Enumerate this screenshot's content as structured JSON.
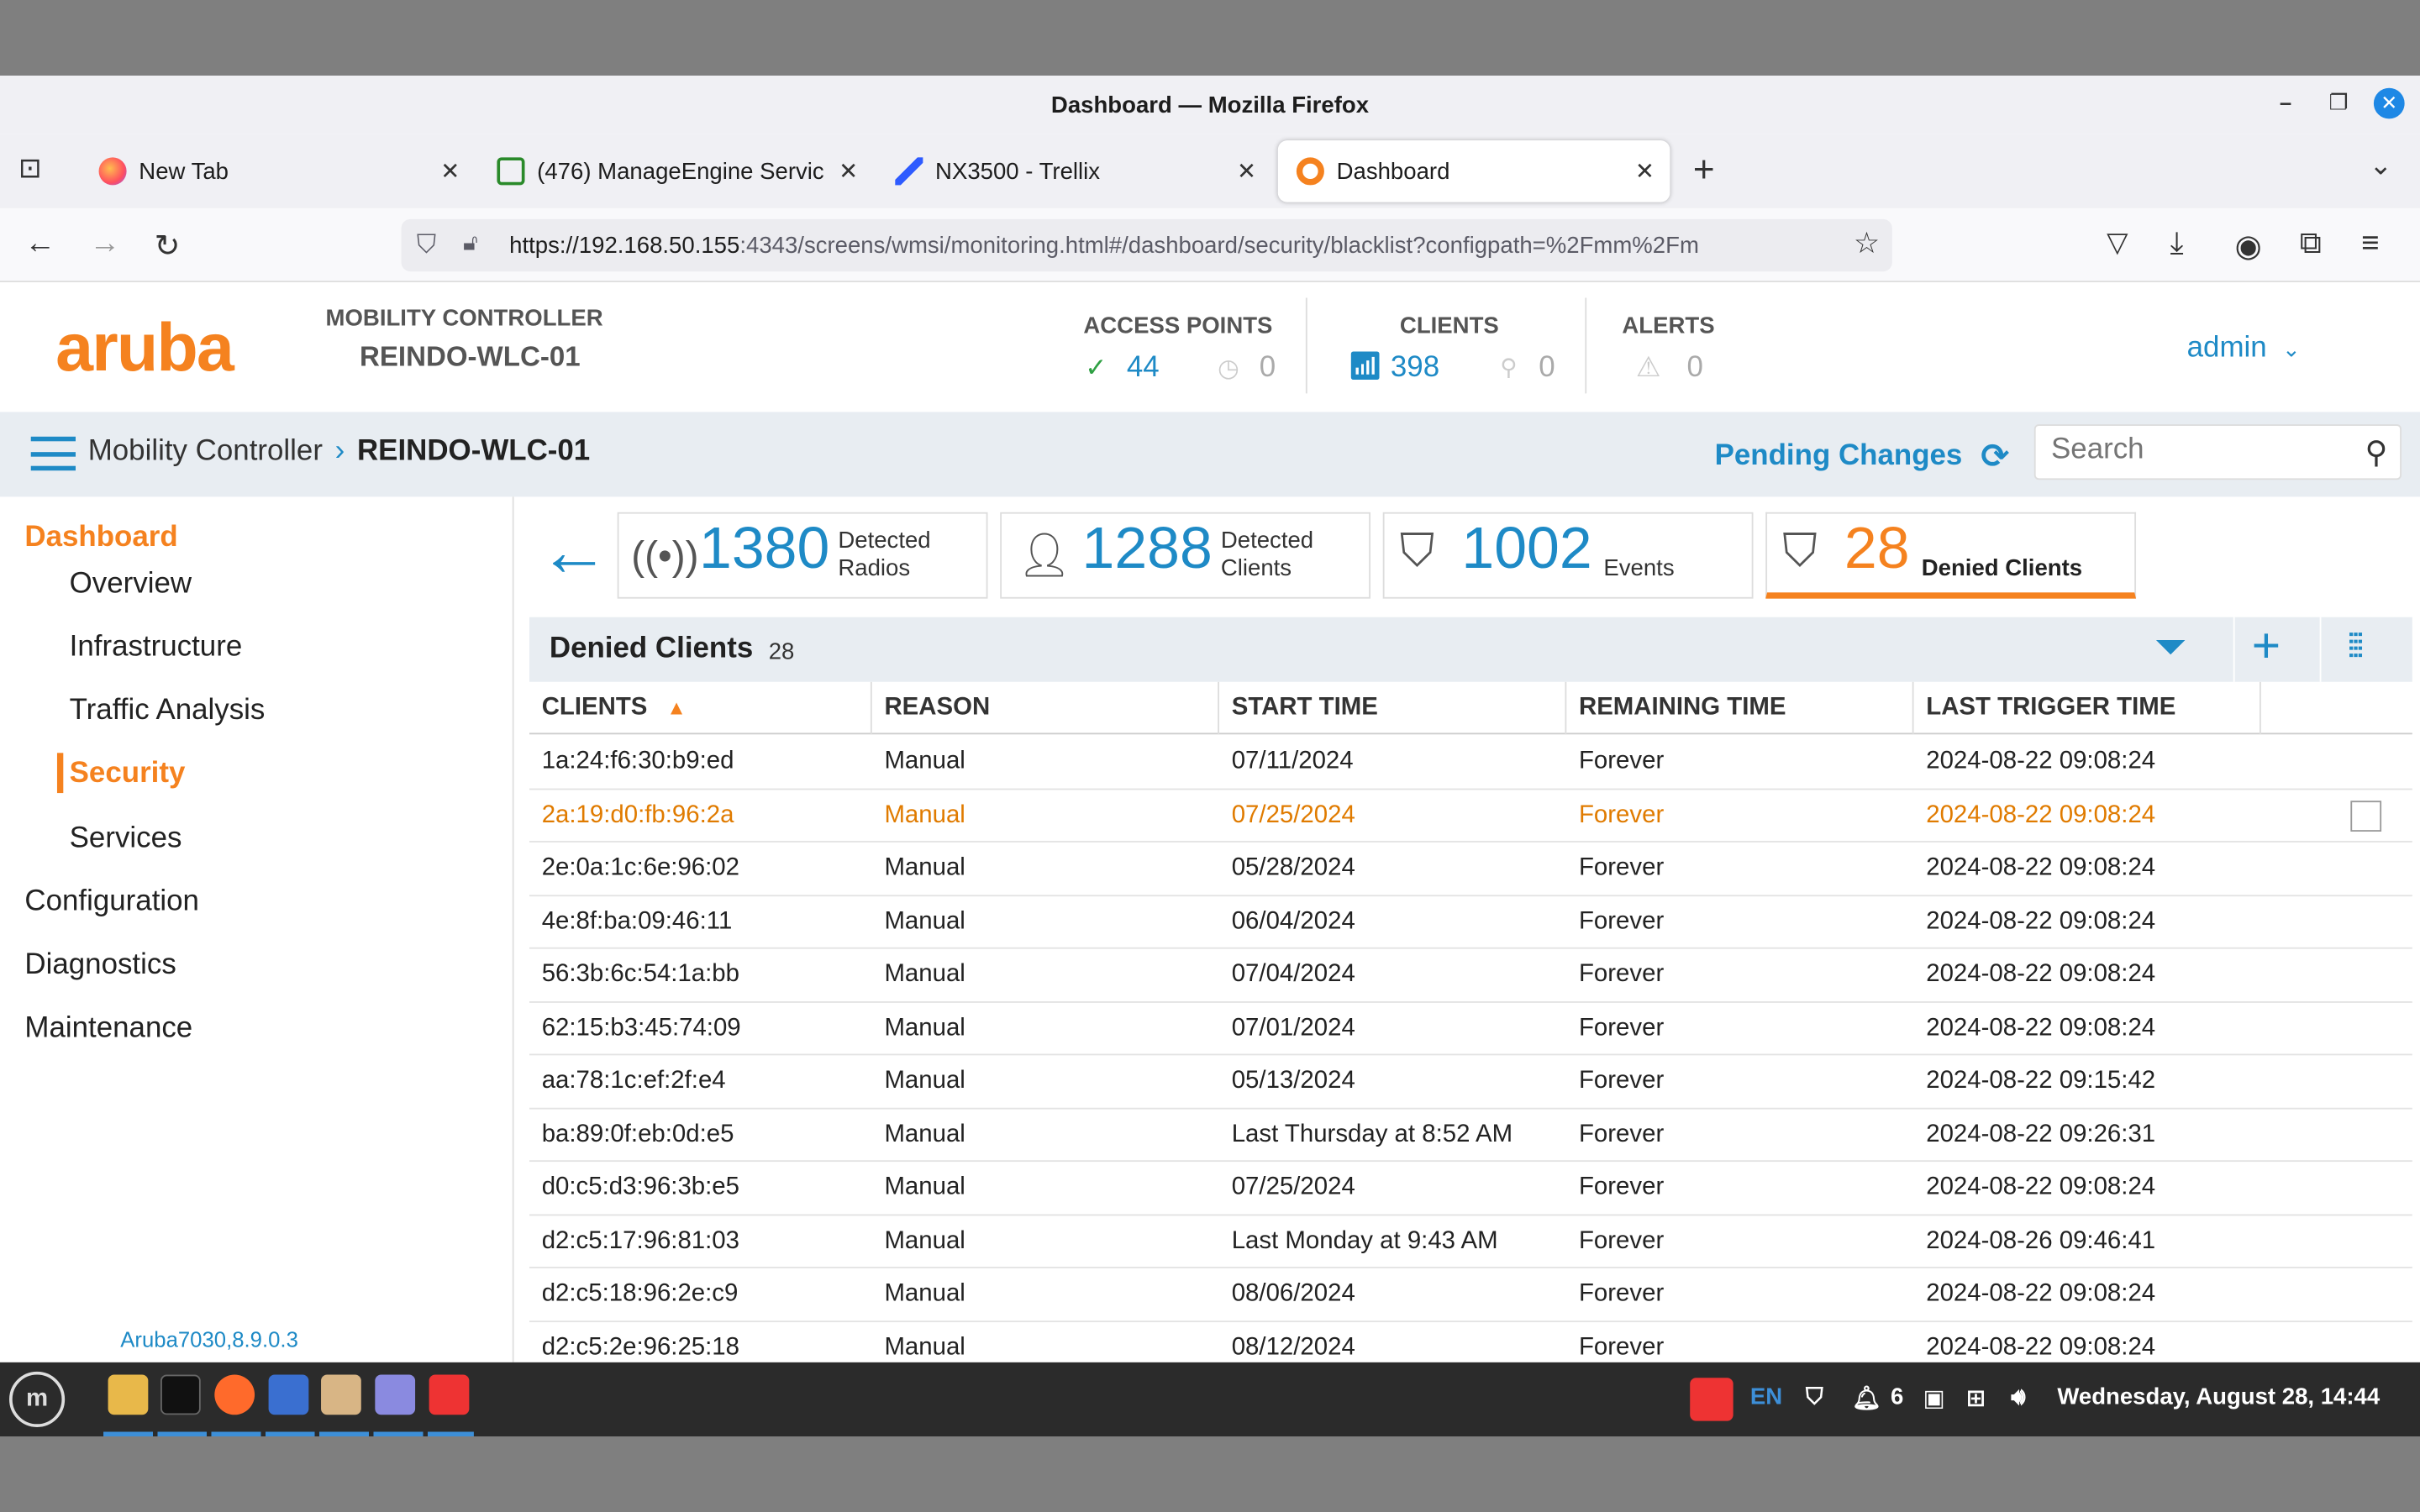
{
  "window": {
    "title": "Dashboard — Mozilla Firefox"
  },
  "tabs": [
    {
      "label": "New Tab",
      "icon": "firefox-icon"
    },
    {
      "label": "(476) ManageEngine Servic",
      "icon": "manageengine-icon"
    },
    {
      "label": "NX3500 - Trellix",
      "icon": "trellix-icon"
    },
    {
      "label": "Dashboard",
      "icon": "aruba-icon",
      "active": true
    }
  ],
  "browser": {
    "url_host": "https://192.168.50.155",
    "url_rest": ":4343/screens/wmsi/monitoring.html#/dashboard/security/blacklist?configpath=%2Fmm%2Fm"
  },
  "header": {
    "logo": "aruba",
    "controller_label": "MOBILITY CONTROLLER",
    "controller_name": "REINDO-WLC-01",
    "access_points": {
      "label": "ACCESS POINTS",
      "up": "44",
      "down": "0"
    },
    "clients": {
      "label": "CLIENTS",
      "wireless": "398",
      "wired": "0"
    },
    "alerts": {
      "label": "ALERTS",
      "count": "0"
    },
    "user": "admin"
  },
  "breadcrumb": {
    "root": "Mobility Controller",
    "current": "REINDO-WLC-01",
    "pending": "Pending Changes",
    "search_placeholder": "Search"
  },
  "sidebar": {
    "items": [
      {
        "label": "Dashboard",
        "level": 0,
        "active": true
      },
      {
        "label": "Overview",
        "level": 1
      },
      {
        "label": "Infrastructure",
        "level": 1
      },
      {
        "label": "Traffic Analysis",
        "level": 1
      },
      {
        "label": "Security",
        "level": 1,
        "active": true
      },
      {
        "label": "Services",
        "level": 1
      },
      {
        "label": "Configuration",
        "level": 0
      },
      {
        "label": "Diagnostics",
        "level": 0
      },
      {
        "label": "Maintenance",
        "level": 0
      }
    ],
    "version": "Aruba7030,8.9.0.3"
  },
  "cards": [
    {
      "value": "1380",
      "label1": "Detected",
      "label2": "Radios",
      "icon": "radio-icon"
    },
    {
      "value": "1288",
      "label1": "Detected",
      "label2": "Clients",
      "icon": "client-icon"
    },
    {
      "value": "1002",
      "label1": "",
      "label2": "Events",
      "icon": "shield-wifi-icon"
    },
    {
      "value": "28",
      "label1": "",
      "label2": "Denied Clients",
      "icon": "shield-x-icon",
      "active": true
    }
  ],
  "table": {
    "title": "Denied Clients",
    "count": "28",
    "columns": [
      "CLIENTS",
      "REASON",
      "START TIME",
      "REMAINING TIME",
      "LAST TRIGGER TIME"
    ],
    "rows": [
      [
        "1a:24:f6:30:b9:ed",
        "Manual",
        "07/11/2024",
        "Forever",
        "2024-08-22 09:08:24"
      ],
      [
        "2a:19:d0:fb:96:2a",
        "Manual",
        "07/25/2024",
        "Forever",
        "2024-08-22 09:08:24"
      ],
      [
        "2e:0a:1c:6e:96:02",
        "Manual",
        "05/28/2024",
        "Forever",
        "2024-08-22 09:08:24"
      ],
      [
        "4e:8f:ba:09:46:11",
        "Manual",
        "06/04/2024",
        "Forever",
        "2024-08-22 09:08:24"
      ],
      [
        "56:3b:6c:54:1a:bb",
        "Manual",
        "07/04/2024",
        "Forever",
        "2024-08-22 09:08:24"
      ],
      [
        "62:15:b3:45:74:09",
        "Manual",
        "07/01/2024",
        "Forever",
        "2024-08-22 09:08:24"
      ],
      [
        "aa:78:1c:ef:2f:e4",
        "Manual",
        "05/13/2024",
        "Forever",
        "2024-08-22 09:15:42"
      ],
      [
        "ba:89:0f:eb:0d:e5",
        "Manual",
        "Last Thursday at 8:52 AM",
        "Forever",
        "2024-08-22 09:26:31"
      ],
      [
        "d0:c5:d3:96:3b:e5",
        "Manual",
        "07/25/2024",
        "Forever",
        "2024-08-22 09:08:24"
      ],
      [
        "d2:c5:17:96:81:03",
        "Manual",
        "Last Monday at 9:43 AM",
        "Forever",
        "2024-08-26 09:46:41"
      ],
      [
        "d2:c5:18:96:2e:c9",
        "Manual",
        "08/06/2024",
        "Forever",
        "2024-08-22 09:08:24"
      ],
      [
        "d2:c5:2e:96:25:18",
        "Manual",
        "08/12/2024",
        "Forever",
        "2024-08-22 09:08:24"
      ]
    ],
    "selected_row": 1
  },
  "taskbar": {
    "lang": "EN",
    "notif_count": "6",
    "clock": "Wednesday, August 28, 14:44"
  },
  "colors": {
    "accent": "#f5821f",
    "link": "#1e8ac6"
  }
}
